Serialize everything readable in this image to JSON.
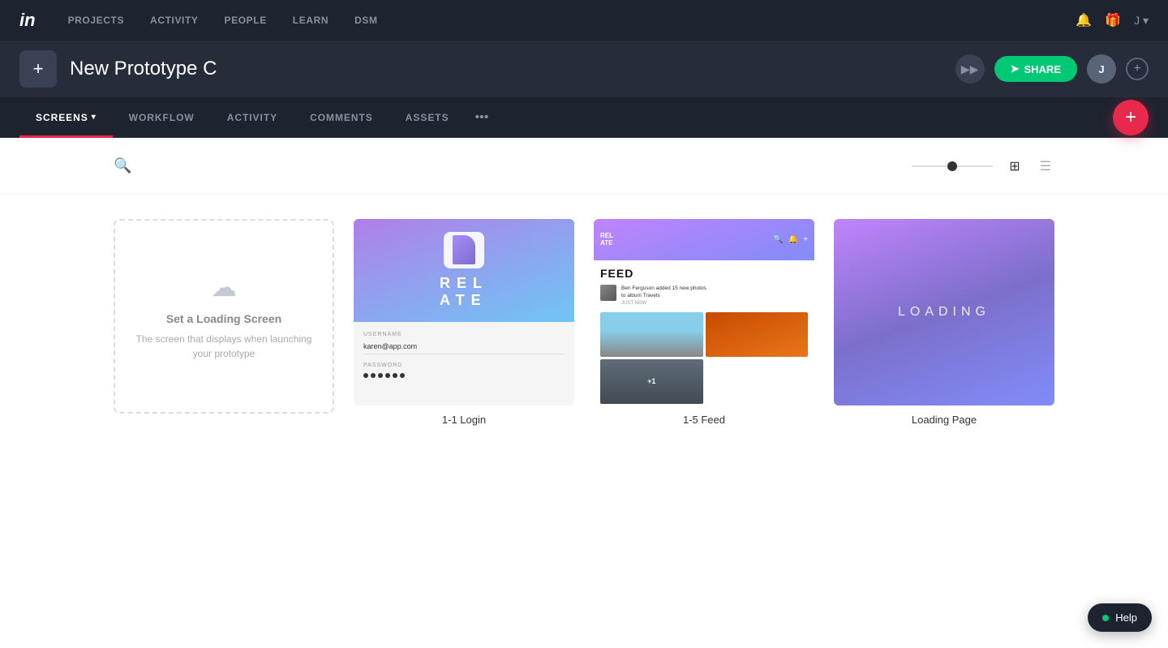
{
  "topNav": {
    "logo": "in",
    "links": [
      "PROJECTS",
      "ACTIVITY",
      "PEOPLE",
      "LEARN",
      "DSM"
    ]
  },
  "projectHeader": {
    "title": "New Prototype C",
    "addLabel": "+",
    "shareLabel": "SHARE",
    "avatarLabel": "J"
  },
  "subNav": {
    "items": [
      "SCREENS",
      "WORKFLOW",
      "ACTIVITY",
      "COMMENTS",
      "ASSETS"
    ],
    "activeItem": "SCREENS",
    "moreLabel": "•••"
  },
  "toolbar": {
    "searchPlaceholder": "Search",
    "gridViewLabel": "⊞",
    "listViewLabel": "☰"
  },
  "screens": {
    "emptyCard": {
      "title": "Set a Loading Screen",
      "description": "The screen that displays when launching your prototype"
    },
    "cards": [
      {
        "id": "1-1-login",
        "name": "1-1 Login",
        "type": "login"
      },
      {
        "id": "1-5-feed",
        "name": "1-5 Feed",
        "type": "feed"
      },
      {
        "id": "loading-page",
        "name": "Loading Page",
        "type": "loading"
      }
    ]
  },
  "feedCard": {
    "logoLine1": "REL",
    "logoLine2": "ATE",
    "titleText": "FEED",
    "postAuthor": "Ben Ferguson added 15 new photos",
    "postAlbum": "to album Travels",
    "postTime": "JUST NOW",
    "overlayCount": "+1"
  },
  "loginCard": {
    "brandText": "REL\nATE",
    "usernameLabel": "USERNAME",
    "usernameValue": "karen@app.com",
    "passwordLabel": "PASSWORD"
  },
  "loadingCard": {
    "text": "LOADING"
  },
  "help": {
    "label": "Help"
  }
}
